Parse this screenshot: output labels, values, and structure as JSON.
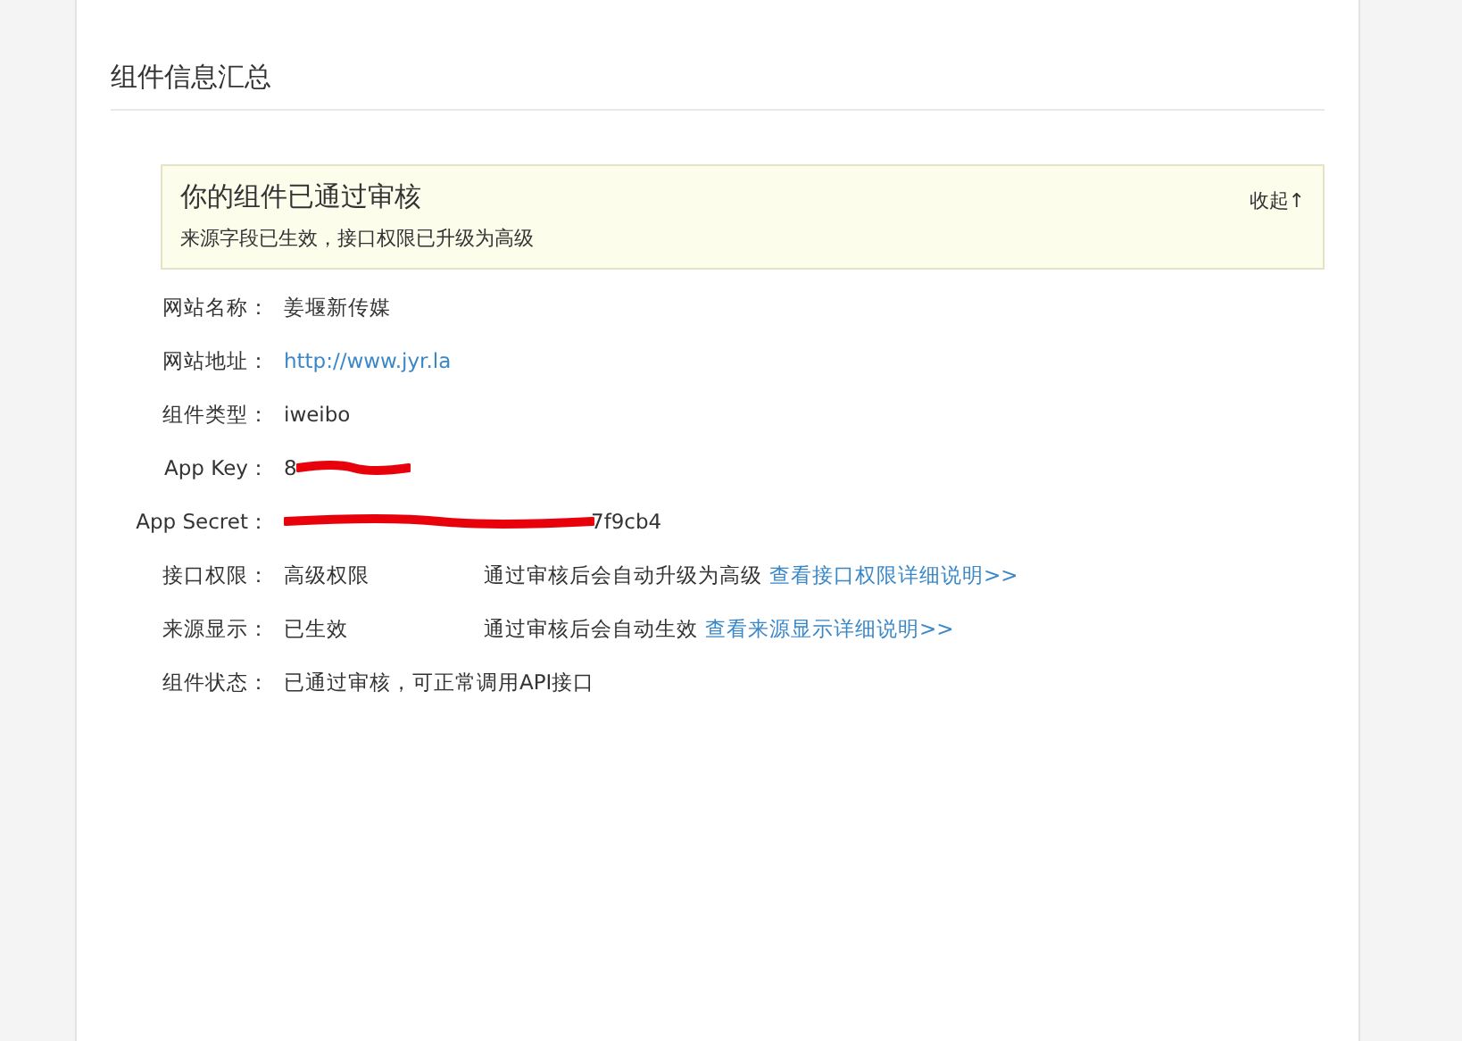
{
  "section": {
    "title": "组件信息汇总"
  },
  "notice": {
    "title": "你的组件已通过审核",
    "message": "来源字段已生效，接口权限已升级为高级",
    "toggle": "收起↑"
  },
  "fields": [
    {
      "label": "网站名称：",
      "value": "姜堰新传媒",
      "kind": "text"
    },
    {
      "label": "网站地址：",
      "value": "http://www.jyr.la",
      "kind": "link"
    },
    {
      "label": "组件类型：",
      "value": "iweibo",
      "kind": "text"
    },
    {
      "label": "App Key：",
      "value": "8",
      "kind": "redacted-after"
    },
    {
      "label": "App Secret：",
      "value": "7f9cb4",
      "kind": "redacted-before"
    },
    {
      "label": "接口权限：",
      "value": "高级权限",
      "kind": "text",
      "note": "通过审核后会自动升级为高级",
      "link": "查看接口权限详细说明>>"
    },
    {
      "label": "来源显示：",
      "value": "已生效",
      "kind": "text",
      "note": "通过审核后会自动生效",
      "link": "查看来源显示详细说明>>"
    },
    {
      "label": "组件状态：",
      "value": "已通过审核，可正常调用API接口",
      "kind": "text"
    }
  ]
}
